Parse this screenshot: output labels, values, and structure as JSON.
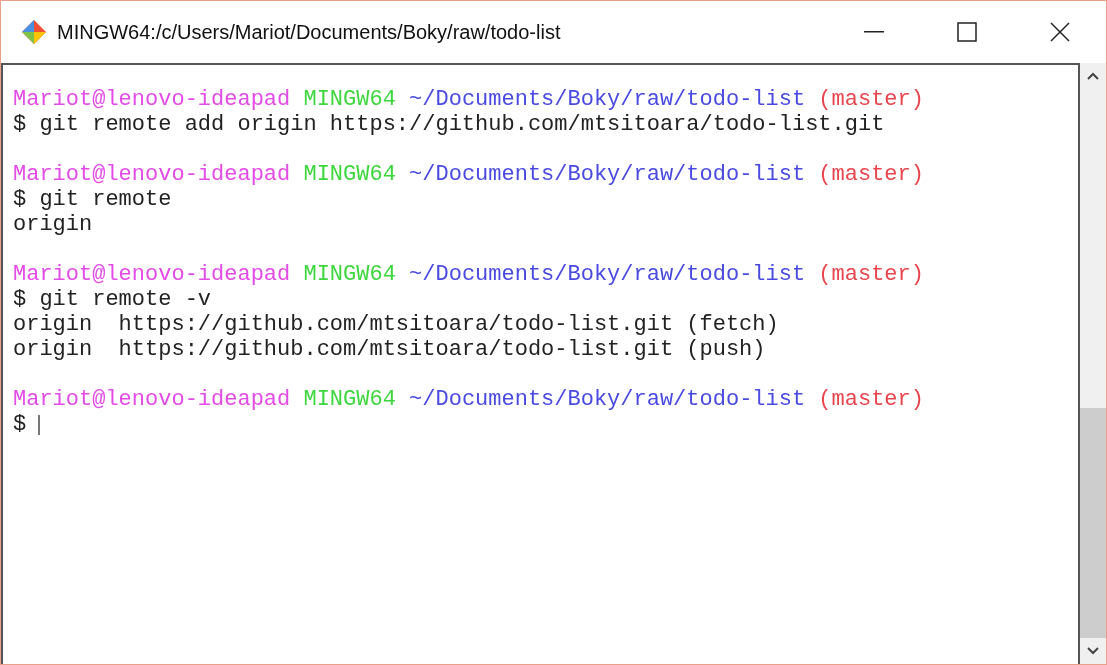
{
  "window": {
    "title": "MINGW64:/c/Users/Mariot/Documents/Boky/raw/todo-list"
  },
  "terminal": {
    "blocks": [
      {
        "prompt": [
          {
            "kind": "user",
            "text": "Mariot@lenovo-ideapad"
          },
          {
            "kind": "system",
            "text": "MINGW64"
          },
          {
            "kind": "path",
            "text": "~/Documents/Boky/raw/todo-list"
          },
          {
            "kind": "branch",
            "text": "(master)"
          }
        ],
        "command": "$ git remote add origin https://github.com/mtsitoara/todo-list.git"
      },
      {
        "prompt": [
          {
            "kind": "user",
            "text": "Mariot@lenovo-ideapad"
          },
          {
            "kind": "system",
            "text": "MINGW64"
          },
          {
            "kind": "path",
            "text": "~/Documents/Boky/raw/todo-list"
          },
          {
            "kind": "branch",
            "text": "(master)"
          }
        ],
        "command": "$ git remote",
        "output": [
          "origin"
        ]
      },
      {
        "prompt": [
          {
            "kind": "user",
            "text": "Mariot@lenovo-ideapad"
          },
          {
            "kind": "system",
            "text": "MINGW64"
          },
          {
            "kind": "path",
            "text": "~/Documents/Boky/raw/todo-list"
          },
          {
            "kind": "branch",
            "text": "(master)"
          }
        ],
        "command": "$ git remote -v",
        "output": [
          "origin  https://github.com/mtsitoara/todo-list.git (fetch)",
          "origin  https://github.com/mtsitoara/todo-list.git (push)"
        ]
      },
      {
        "prompt": [
          {
            "kind": "user",
            "text": "Mariot@lenovo-ideapad"
          },
          {
            "kind": "system",
            "text": "MINGW64"
          },
          {
            "kind": "path",
            "text": "~/Documents/Boky/raw/todo-list"
          },
          {
            "kind": "branch",
            "text": "(master)"
          }
        ],
        "command": "$",
        "cursor": true
      }
    ]
  }
}
